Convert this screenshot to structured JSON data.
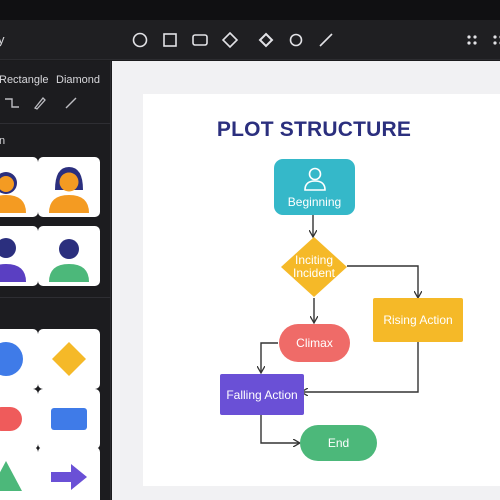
{
  "app": {
    "title_fragment": "y"
  },
  "toolbar": {
    "tools": [
      {
        "name": "ellipse-tool",
        "icon": "circle-icon",
        "active": true
      },
      {
        "name": "rectangle-tool",
        "icon": "square-icon"
      },
      {
        "name": "rounded-rect-tool",
        "icon": "rounded-rect-icon"
      },
      {
        "name": "diamond-tool",
        "icon": "diamond-icon"
      },
      {
        "name": "filled-diamond-tool",
        "icon": "diamond-filled-icon"
      },
      {
        "name": "small-circle-tool",
        "icon": "circle-small-icon"
      },
      {
        "name": "line-tool",
        "icon": "line-icon"
      },
      {
        "name": "grid-menu",
        "icon": "dots-grid-icon"
      },
      {
        "name": "settings-menu",
        "icon": "more-icon"
      }
    ]
  },
  "sidebar": {
    "shape_labels": [
      "Rectangle",
      "Diamond"
    ],
    "line_tools": [
      "step-line-icon",
      "pen-icon",
      "straight-line-icon"
    ],
    "section_label": "n",
    "people_tiles": [
      "person-orange-icon",
      "person-woman-orange-icon",
      "person-purple-icon",
      "person-green-icon"
    ],
    "shape_tiles": [
      "circle-blue-icon",
      "diamond-yellow-icon",
      "oval-red-icon",
      "rectangle-blue-icon",
      "triangle-green-icon",
      "arrow-purple-icon"
    ]
  },
  "diagram": {
    "title": "PLOT STRUCTURE",
    "nodes": {
      "beginning": "Beginning",
      "inciting_1": "Inciting",
      "inciting_2": "Incident",
      "rising": "Rising Action",
      "climax": "Climax",
      "falling": "Falling Action",
      "end": "End"
    },
    "colors": {
      "beginning": "#35b8c9",
      "inciting": "#f5b928",
      "rising": "#f5b928",
      "climax": "#ef6b68",
      "falling": "#6a50d6",
      "end": "#4cb87a",
      "title": "#2b2f7e",
      "connector": "#333333"
    }
  }
}
